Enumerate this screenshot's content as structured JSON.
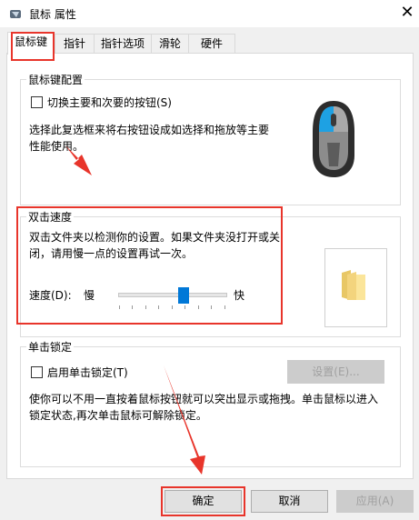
{
  "window": {
    "title": "鼠标 属性",
    "close_glyph": "✕"
  },
  "tabs": [
    {
      "label": "鼠标键",
      "active": true
    },
    {
      "label": "指针"
    },
    {
      "label": "指针选项"
    },
    {
      "label": "滑轮"
    },
    {
      "label": "硬件"
    }
  ],
  "button_config": {
    "legend": "鼠标键配置",
    "swap_label": "切换主要和次要的按钮(S)",
    "swap_checked": false,
    "description": "选择此复选框来将右按钮设成如选择和拖放等主要性能使用。"
  },
  "double_click": {
    "legend": "双击速度",
    "description": "双击文件夹以检测你的设置。如果文件夹没打开或关闭，请用慢一点的设置再试一次。",
    "speed_label": "速度(D):",
    "slow_label": "慢",
    "fast_label": "快",
    "speed_fraction": 0.6
  },
  "click_lock": {
    "legend": "单击锁定",
    "enable_label": "启用单击锁定(T)",
    "enable_checked": false,
    "settings_button": "设置(E)...",
    "description": "使你可以不用一直按着鼠标按钮就可以突出显示或拖拽。单击鼠标以进入锁定状态,再次单击鼠标可解除锁定。"
  },
  "footer": {
    "ok": "确定",
    "cancel": "取消",
    "apply": "应用(A)"
  },
  "colors": {
    "accent": "#0078d7",
    "annotation": "#e8352b"
  }
}
